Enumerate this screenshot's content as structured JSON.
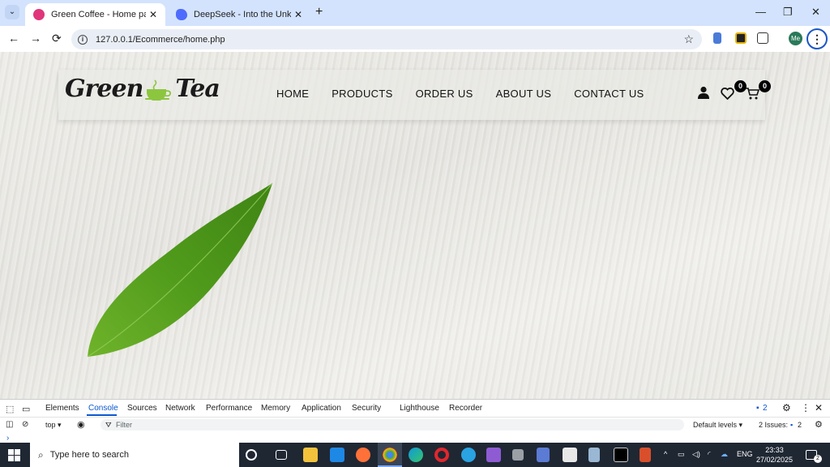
{
  "browser": {
    "tabs": [
      {
        "title": "Green Coffee - Home page",
        "close": "✕"
      },
      {
        "title": "DeepSeek - Into the Unknown",
        "close": "✕"
      }
    ],
    "new_tab": "+",
    "window_controls": {
      "minimize": "—",
      "restore": "❐",
      "close": "✕"
    },
    "url": "127.0.0.1/Ecommerce/home.php",
    "profile_initials": "Me"
  },
  "site": {
    "logo": {
      "word1": "Green",
      "word2": "Tea"
    },
    "nav": [
      "HOME",
      "PRODUCTS",
      "ORDER US",
      "ABOUT US",
      "CONTACT US"
    ],
    "wishlist_count": "0",
    "cart_count": "0"
  },
  "devtools": {
    "tabs": [
      "Elements",
      "Console",
      "Sources",
      "Network",
      "Performance",
      "Memory",
      "Application",
      "Security",
      "Lighthouse",
      "Recorder"
    ],
    "active_tab": "Console",
    "messages_badge": "2",
    "context": "top ▾",
    "filter_placeholder": "Filter",
    "levels": "Default levels ▾",
    "issues_label": "2 Issues:",
    "issues_count": "2",
    "prompt": "›"
  },
  "taskbar": {
    "search_placeholder": "Type here to search",
    "language": "ENG",
    "time": "23:33",
    "date": "27/02/2025",
    "notifications": "2"
  },
  "colors": {
    "brand_green": "#8cc63f",
    "accent_blue": "#0b57d0"
  }
}
